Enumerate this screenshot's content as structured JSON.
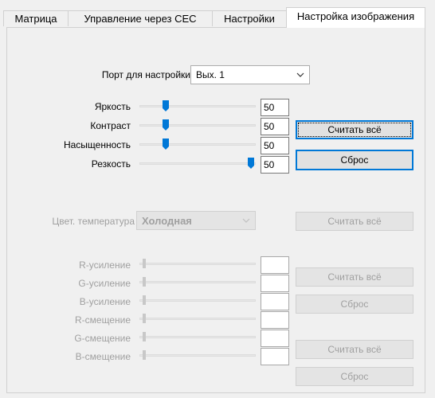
{
  "tabs": [
    {
      "label": "Матрица",
      "active": false
    },
    {
      "label": "Управление через CEC",
      "active": false
    },
    {
      "label": "Настройки",
      "active": false
    },
    {
      "label": "Настройка изображения",
      "active": true
    }
  ],
  "port": {
    "label": "Порт для настройки",
    "value": "Вых. 1",
    "icon": "chevron-down-icon"
  },
  "adjust": [
    {
      "label": "Яркость",
      "value": "50",
      "level": 0.2
    },
    {
      "label": "Контраст",
      "value": "50",
      "level": 0.2
    },
    {
      "label": "Насыщенность",
      "value": "50",
      "level": 0.2
    },
    {
      "label": "Резкость",
      "value": "50",
      "level": 1.0
    }
  ],
  "adjust_buttons": {
    "read_all": "Считать всё",
    "reset": "Сброс"
  },
  "color_temp": {
    "label": "Цвет. температура",
    "value": "Холодная",
    "read_all": "Считать всё"
  },
  "rgb": [
    {
      "label": "R-усиление",
      "value": ""
    },
    {
      "label": "G-усиление",
      "value": ""
    },
    {
      "label": "B-усиление",
      "value": ""
    },
    {
      "label": "R-смещение",
      "value": ""
    },
    {
      "label": "G-смещение",
      "value": ""
    },
    {
      "label": "B-смещение",
      "value": ""
    }
  ],
  "gain_buttons": {
    "read_all": "Считать всё",
    "reset": "Сброс"
  },
  "offset_buttons": {
    "read_all": "Считать всё",
    "reset": "Сброс"
  },
  "colors": {
    "accent": "#0078d7",
    "disabled_text": "#a0a0a0",
    "thumb": "#0078d7",
    "thumb_disabled": "#c8c8c8"
  }
}
